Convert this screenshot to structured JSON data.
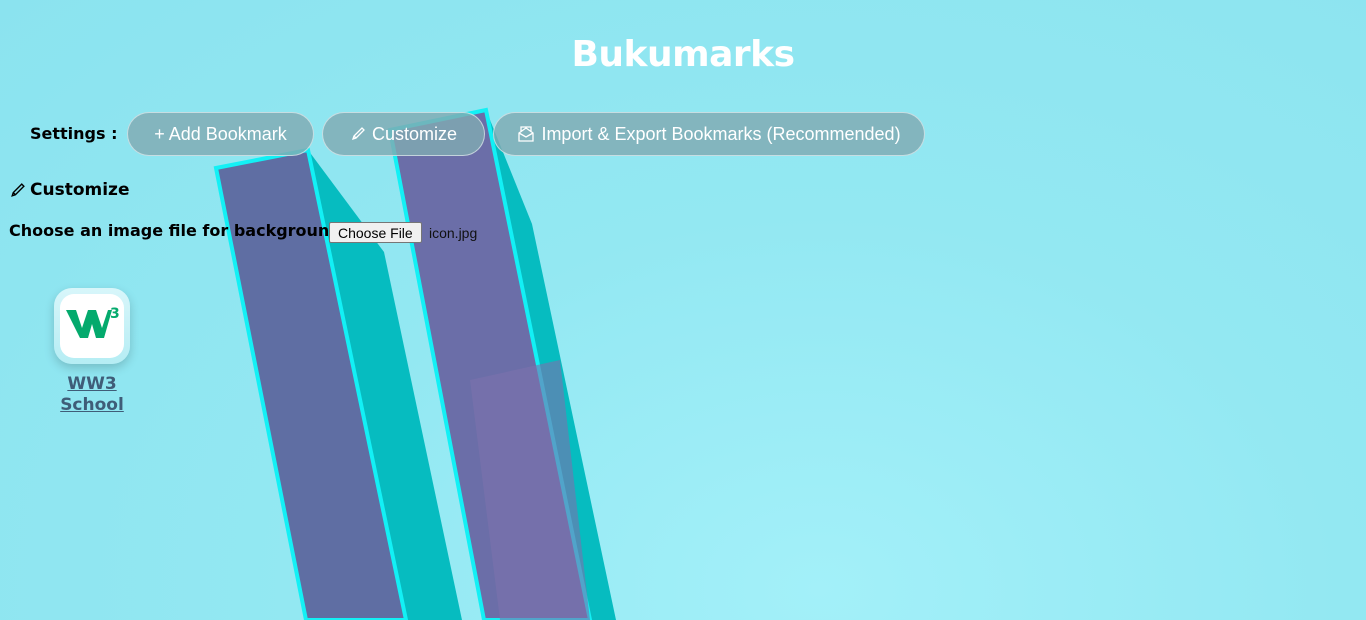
{
  "page": {
    "title": "Bukumarks"
  },
  "settings": {
    "label": "Settings :",
    "buttons": {
      "add_bookmark": "+ Add Bookmark",
      "customize": "Customize",
      "import_export": "Import & Export Bookmarks (Recommended)"
    }
  },
  "customize_panel": {
    "heading": "Customize",
    "background_label": "Choose an image file for background:",
    "file_button": "Choose File",
    "file_name": "icon.jpg"
  },
  "bookmarks": [
    {
      "label": "WW3 School",
      "icon": "w3-logo-icon",
      "icon_color": "#04aa6d"
    }
  ],
  "colors": {
    "background": "#92e7f1",
    "button_bg": "#80aab2",
    "title": "#ffffff",
    "bookmark_label": "#3f5d78"
  }
}
